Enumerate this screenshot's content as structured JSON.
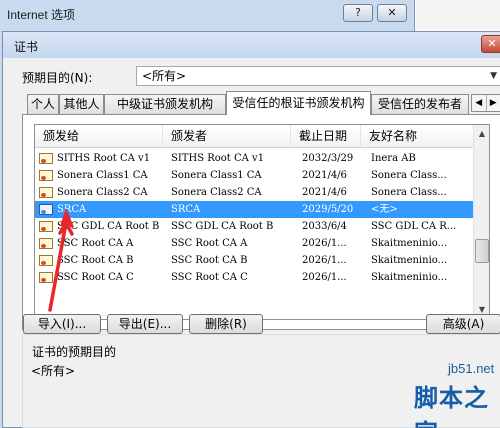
{
  "background_window": {
    "title": "Internet 选项",
    "help_button": "?",
    "close_button": "✕"
  },
  "dialog": {
    "title": "证书",
    "close_button": "✕",
    "intended_purpose": {
      "label": "预期目的(N):",
      "selected": "<所有>"
    },
    "tabs": [
      {
        "label": "个人",
        "active": false
      },
      {
        "label": "其他人",
        "active": false
      },
      {
        "label": "中级证书颁发机构",
        "active": false
      },
      {
        "label": "受信任的根证书颁发机构",
        "active": true
      },
      {
        "label": "受信任的发布者",
        "active": false
      }
    ],
    "tab_scroll": {
      "left": "◀",
      "right": "▶"
    },
    "columns": [
      "颁发给",
      "颁发者",
      "截止日期",
      "友好名称"
    ],
    "certificates": [
      {
        "issued_to": "SITHS Root CA v1",
        "issued_by": "SITHS Root CA v1",
        "expires": "2032/3/29",
        "friendly_name": "Inera AB",
        "selected": false
      },
      {
        "issued_to": "Sonera Class1 CA",
        "issued_by": "Sonera Class1 CA",
        "expires": "2021/4/6",
        "friendly_name": "Sonera Class...",
        "selected": false
      },
      {
        "issued_to": "Sonera Class2 CA",
        "issued_by": "Sonera Class2 CA",
        "expires": "2021/4/6",
        "friendly_name": "Sonera Class...",
        "selected": false
      },
      {
        "issued_to": "SRCA",
        "issued_by": "SRCA",
        "expires": "2029/5/20",
        "friendly_name": "<无>",
        "selected": true
      },
      {
        "issued_to": "SSC GDL CA Root B",
        "issued_by": "SSC GDL CA Root B",
        "expires": "2033/6/4",
        "friendly_name": "SSC GDL CA R...",
        "selected": false
      },
      {
        "issued_to": "SSC Root CA A",
        "issued_by": "SSC Root CA A",
        "expires": "2026/1...",
        "friendly_name": "Skaitmeninio...",
        "selected": false
      },
      {
        "issued_to": "SSC Root CA B",
        "issued_by": "SSC Root CA B",
        "expires": "2026/1...",
        "friendly_name": "Skaitmeninio...",
        "selected": false
      },
      {
        "issued_to": "SSC Root CA C",
        "issued_by": "SSC Root CA C",
        "expires": "2026/1...",
        "friendly_name": "Skaitmeninio...",
        "selected": false
      }
    ],
    "scrollbar": {
      "up": "▲",
      "down": "▼"
    },
    "buttons": {
      "import": "导入(I)...",
      "export": "导出(E)...",
      "remove": "删除(R)",
      "advanced": "高级(A)"
    },
    "purposes_section": {
      "title": "证书的预期目的",
      "value": "<所有>"
    }
  },
  "watermark": {
    "domain": "jb51.net",
    "text": "脚本之家"
  },
  "colors": {
    "selection": "#3399ff",
    "annotation_arrow": "#e8262b",
    "watermark": "#155da8"
  }
}
